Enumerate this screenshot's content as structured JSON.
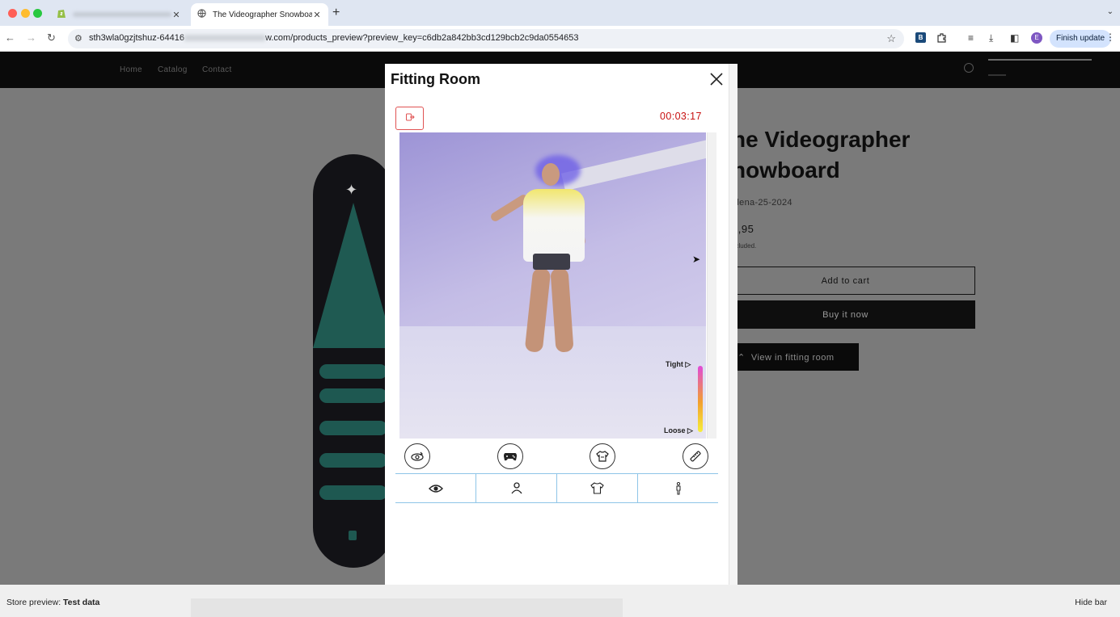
{
  "browser": {
    "tabs": [
      {
        "title": "",
        "active": false
      },
      {
        "title": "The Videographer Snowboard",
        "active": true
      }
    ],
    "url_prefix": "sth3wla0gzjtshuz-64416",
    "url_suffix": "w.com/products_preview?preview_key=c6db2a842bb3cd129bcb2c9da0554653",
    "finish_update_label": "Finish update",
    "profile_initial": "E",
    "extension_badge": "B"
  },
  "store": {
    "menu": [
      "Home",
      "Catalog",
      "Contact"
    ],
    "product": {
      "title_line1": "he Videographer",
      "title_line2": "nowboard",
      "vendor": "elena-25-2024",
      "price": "5,95",
      "tax_note": "ncluded.",
      "add_to_cart": "Add to cart",
      "buy_now": "Buy it now",
      "view_fitting": "View in fitting room"
    }
  },
  "fitting_room": {
    "title": "Fitting Room",
    "timer": "00:03:17",
    "fit_scale": {
      "tight_label": "Tight",
      "loose_label": "Loose"
    },
    "controls": [
      "rotate-icon",
      "gamepad-icon",
      "tshirt-fit-icon",
      "measure-icon"
    ],
    "tabs": [
      "eye-icon",
      "person-icon",
      "tshirt-icon",
      "body-icon"
    ]
  },
  "bottom_bar": {
    "label": "Store preview:",
    "value": "Test data",
    "hide": "Hide bar"
  },
  "colors": {
    "timer": "#c81010",
    "exit_button": "#e05252",
    "tab_border": "#8ec5e8",
    "finish_update_bg": "#d3e3fd"
  }
}
